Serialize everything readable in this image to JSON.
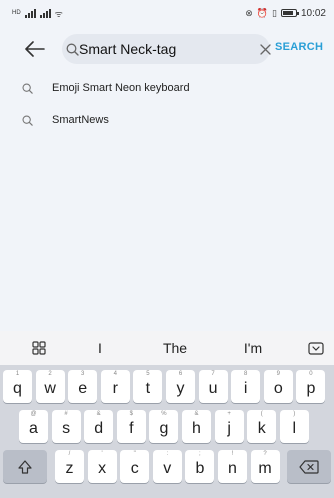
{
  "status_bar": {
    "carrier_left": "HD",
    "time": "10:02",
    "battery_level": 0.8,
    "icons": [
      "signal-icon",
      "nfc-icon",
      "alarm-icon",
      "vibrate-icon",
      "battery-icon"
    ]
  },
  "search": {
    "query": "Smart Neck-tag",
    "placeholder": "",
    "action_label": "SEARCH",
    "back_icon": "back-arrow-icon",
    "search_icon": "search-icon",
    "clear_icon": "close-icon"
  },
  "suggestions": [
    {
      "label": "Emoji Smart Neon keyboard"
    },
    {
      "label": "SmartNews"
    }
  ],
  "keyboard": {
    "toolbar": {
      "left_icon": "grid-icon",
      "predictions": [
        "I",
        "The",
        "I'm"
      ],
      "right_icon": "keyboard-hide-icon"
    },
    "row1": [
      {
        "key": "q",
        "hint": "1"
      },
      {
        "key": "w",
        "hint": "2"
      },
      {
        "key": "e",
        "hint": "3"
      },
      {
        "key": "r",
        "hint": "4"
      },
      {
        "key": "t",
        "hint": "5"
      },
      {
        "key": "y",
        "hint": "6"
      },
      {
        "key": "u",
        "hint": "7"
      },
      {
        "key": "i",
        "hint": "8"
      },
      {
        "key": "o",
        "hint": "9"
      },
      {
        "key": "p",
        "hint": "0"
      }
    ],
    "row2": [
      {
        "key": "a",
        "hint": "@"
      },
      {
        "key": "s",
        "hint": "#"
      },
      {
        "key": "d",
        "hint": "&"
      },
      {
        "key": "f",
        "hint": "$"
      },
      {
        "key": "g",
        "hint": "%"
      },
      {
        "key": "h",
        "hint": "&"
      },
      {
        "key": "j",
        "hint": "+"
      },
      {
        "key": "k",
        "hint": "("
      },
      {
        "key": "l",
        "hint": ")"
      }
    ],
    "row3": [
      {
        "key": "z",
        "hint": "/"
      },
      {
        "key": "x",
        "hint": "'"
      },
      {
        "key": "c",
        "hint": "\""
      },
      {
        "key": "v",
        "hint": ":"
      },
      {
        "key": "b",
        "hint": ";"
      },
      {
        "key": "n",
        "hint": "!"
      },
      {
        "key": "m",
        "hint": "?"
      }
    ],
    "shift_icon": "shift-icon",
    "backspace_icon": "backspace-icon"
  }
}
